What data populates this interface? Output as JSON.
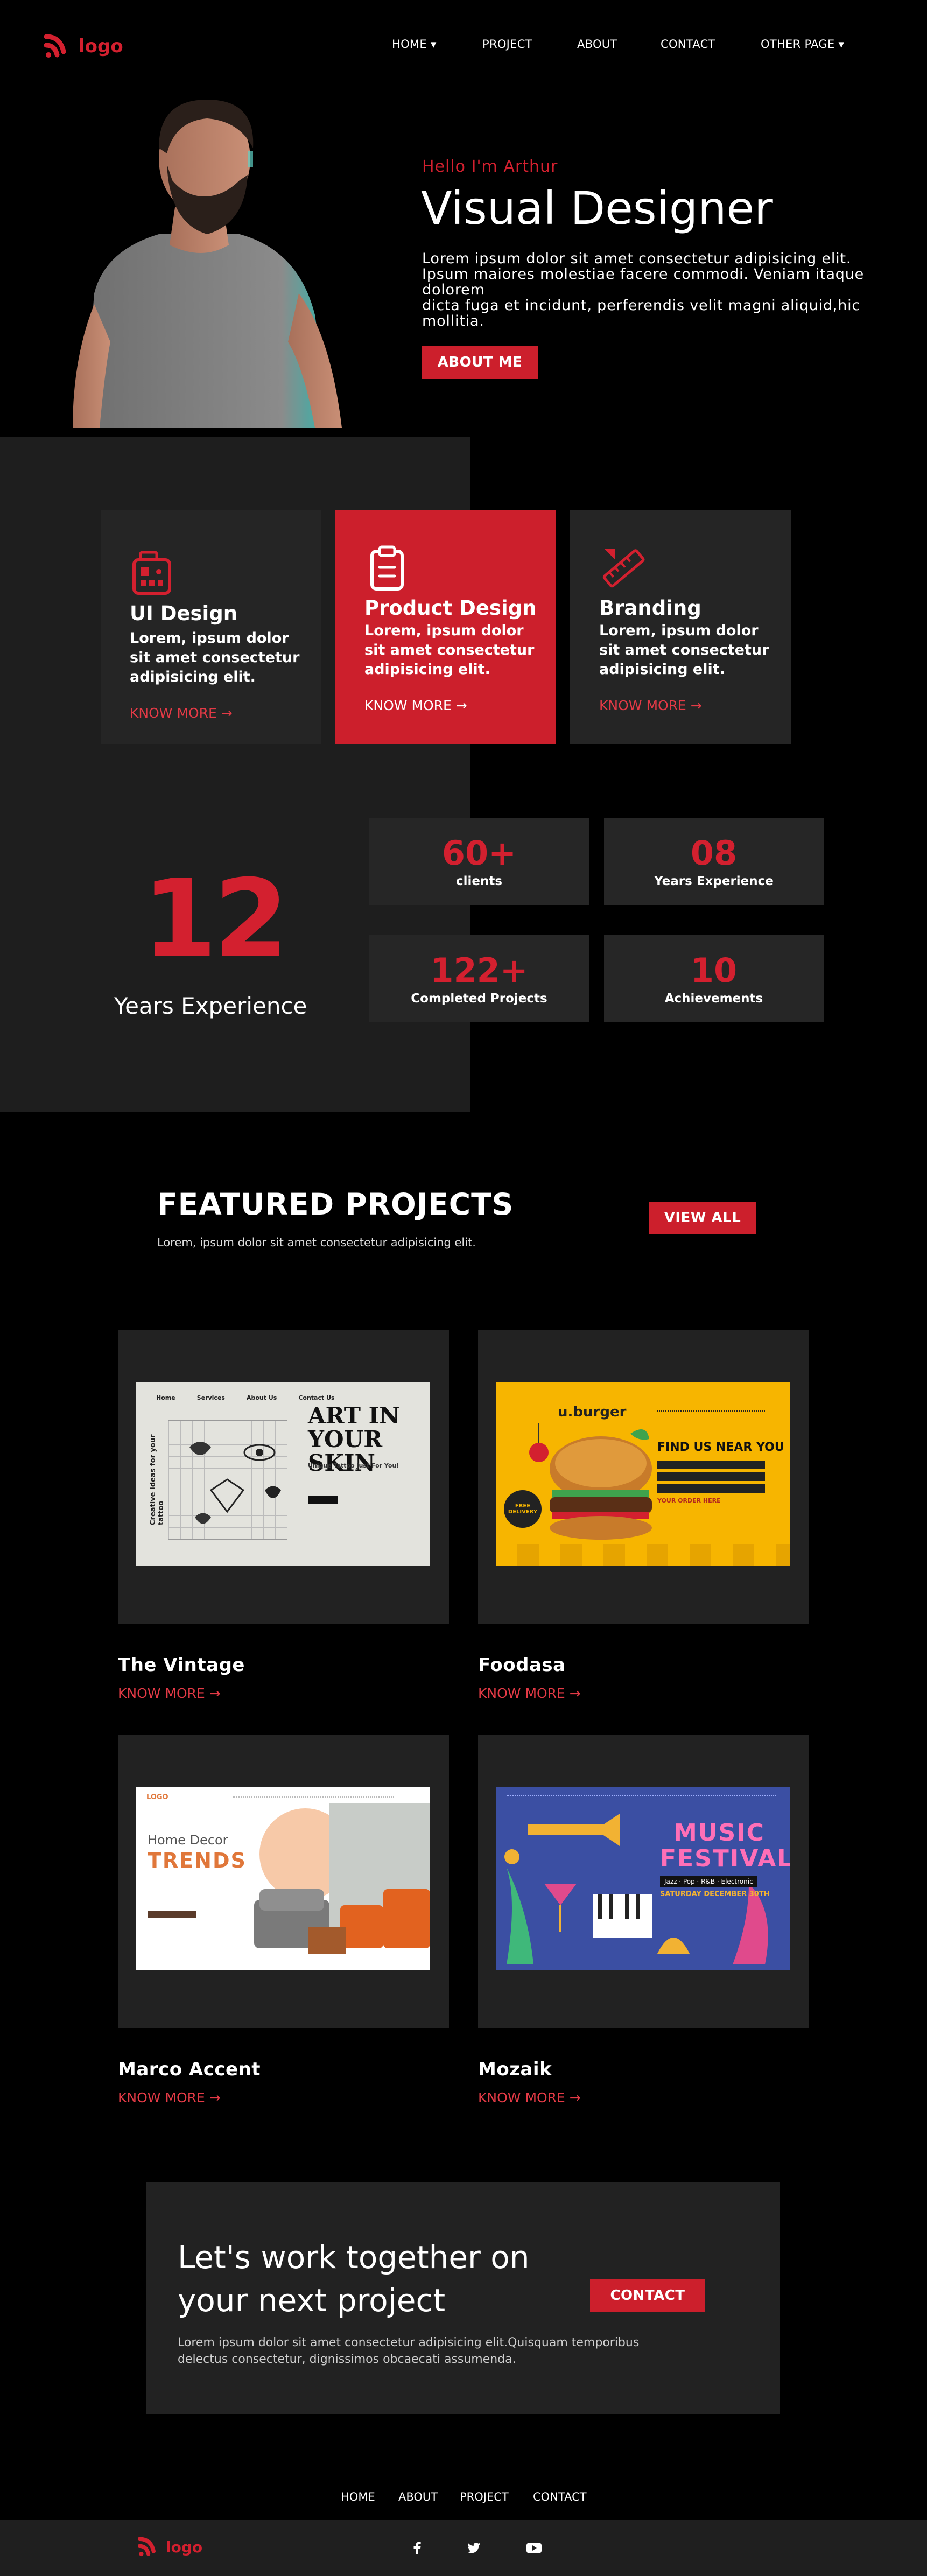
{
  "header": {
    "logo_text": "logo",
    "nav": [
      {
        "label": "HOME ▾"
      },
      {
        "label": "PROJECT"
      },
      {
        "label": "ABOUT"
      },
      {
        "label": "CONTACT"
      },
      {
        "label": "OTHER PAGE ▾"
      }
    ]
  },
  "hero": {
    "greeting": "Hello I'm Arthur",
    "title": "Visual Designer",
    "desc_line1": "Lorem ipsum dolor sit amet consectetur adipisicing elit.",
    "desc_line2": "Ipsum maiores molestiae facere commodi. Veniam itaque",
    "desc_line3": "dolorem",
    "desc_line4": "dicta fuga et incidunt, perferendis velit magni aliquid,hic mollitia.",
    "cta_label": "ABOUT ME"
  },
  "services": [
    {
      "title": "UI Design",
      "desc": "Lorem, ipsum dolor sit amet consectetur adipisicing elit.",
      "link": "KNOW MORE →",
      "icon": "ui-design-icon"
    },
    {
      "title": "Product Design",
      "desc": "Lorem, ipsum dolor sit amet consectetur adipisicing elit.",
      "link": "KNOW MORE →",
      "icon": "clipboard-icon"
    },
    {
      "title": "Branding",
      "desc": "Lorem, ipsum dolor sit amet consectetur adipisicing elit.",
      "link": "KNOW MORE →",
      "icon": "ruler-pencil-icon"
    }
  ],
  "experience": {
    "big_number": "12",
    "big_label": "Years Experience",
    "stats": [
      {
        "value": "60+",
        "label": "clients"
      },
      {
        "value": "08",
        "label": "Years Experience"
      },
      {
        "value": "122+",
        "label": "Completed Projects"
      },
      {
        "value": "10",
        "label": "Achievements"
      }
    ]
  },
  "featured": {
    "heading": "FEATURED PROJECTS",
    "subheading": "Lorem, ipsum dolor sit amet consectetur adipisicing elit.",
    "view_all": "VIEW ALL",
    "projects": [
      {
        "title": "The Vintage",
        "link": "KNOW MORE →"
      },
      {
        "title": "Foodasa",
        "link": "KNOW MORE →"
      },
      {
        "title": "Marco Accent",
        "link": "KNOW MORE →"
      },
      {
        "title": "Mozaik",
        "link": "KNOW MORE →"
      }
    ],
    "thumbs": {
      "vintage": {
        "headline": "ART IN YOUR SKIN",
        "nav": [
          "Home",
          "Services",
          "About Us",
          "Contact Us"
        ],
        "side": "Creative Ideas for your tattoo",
        "tagline": "Unique Tattoo Just For You!"
      },
      "foodasa": {
        "brand": "u.burger",
        "headline": "FIND US NEAR YOU",
        "badge": "FREE DELIVERY",
        "order": "YOUR ORDER HERE"
      },
      "marco": {
        "brand": "LOGO",
        "line1": "Home Decor",
        "line2": "TRENDS"
      },
      "mozaik": {
        "line1": "MUSIC",
        "line2": "FESTIVAL",
        "tags": "Jazz · Pop · R&B · Electronic",
        "date": "SATURDAY DECEMBER 30TH"
      }
    }
  },
  "cta": {
    "title_line1": "Let's work together on",
    "title_line2": "your next project",
    "desc_line1": "Lorem ipsum dolor sit amet consectetur adipisicing elit.Quisquam temporibus",
    "desc_line2": "delectus consectetur, dignissimos obcaecati assumenda.",
    "button": "CONTACT"
  },
  "footer": {
    "links": [
      "HOME",
      "ABOUT",
      "PROJECT",
      "CONTACT"
    ],
    "logo_text": "logo",
    "social_icons": [
      "facebook-icon",
      "twitter-icon",
      "youtube-icon"
    ]
  },
  "colors": {
    "accent": "#cc1f2c",
    "panel": "#1e1e1e",
    "card": "#252525",
    "background": "#000000"
  }
}
